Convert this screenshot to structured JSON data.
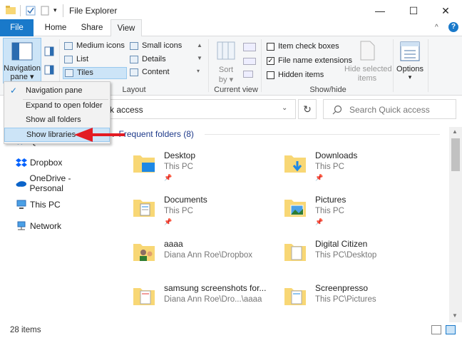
{
  "window": {
    "title": "File Explorer",
    "min": "—",
    "max": "☐",
    "close": "✕"
  },
  "tabs": [
    {
      "label": "File"
    },
    {
      "label": "Home"
    },
    {
      "label": "Share"
    },
    {
      "label": "View"
    }
  ],
  "ribbon": {
    "nav_pane": "Navigation\npane ▾",
    "nav_pane_line1": "Navigation",
    "nav_pane_line2": "pane ▾",
    "layouts": [
      "Medium icons",
      "Small icons",
      "List",
      "Details",
      "Tiles",
      "Content"
    ],
    "layout_group": "Layout",
    "sort_label": "Sort\nby",
    "sort_line1": "Sort",
    "sort_line2": "by ▾",
    "current_view_group": "Current view",
    "checks": [
      {
        "label": "Item check boxes",
        "checked": false
      },
      {
        "label": "File name extensions",
        "checked": true
      },
      {
        "label": "Hidden items",
        "checked": false
      }
    ],
    "hide_selected_line1": "Hide selected",
    "hide_selected_line2": "items",
    "options_label": "Options",
    "options_arrow": "▾",
    "show_hide_group": "Show/hide"
  },
  "menu": {
    "items": [
      {
        "label": "Navigation pane",
        "checked": true
      },
      {
        "label": "Expand to open folder",
        "checked": false
      },
      {
        "label": "Show all folders",
        "checked": false
      },
      {
        "label": "Show libraries",
        "checked": false
      }
    ]
  },
  "address": {
    "path_fragment": "ck access",
    "search_placeholder": "Search Quick access"
  },
  "nav": [
    {
      "label": "Quick access"
    },
    {
      "label": "Dropbox"
    },
    {
      "label": "OneDrive - Personal"
    },
    {
      "label": "This PC"
    },
    {
      "label": "Network"
    }
  ],
  "section": {
    "title": "Frequent folders (8)"
  },
  "tiles": [
    {
      "name": "Desktop",
      "sub": "This PC",
      "icon": "desktop-folder-icon"
    },
    {
      "name": "Downloads",
      "sub": "This PC",
      "icon": "downloads-folder-icon"
    },
    {
      "name": "Documents",
      "sub": "This PC",
      "icon": "documents-folder-icon"
    },
    {
      "name": "Pictures",
      "sub": "This PC",
      "icon": "pictures-folder-icon"
    },
    {
      "name": "aaaa",
      "sub": "Diana Ann Roe\\Dropbox",
      "icon": "shared-folder-icon"
    },
    {
      "name": "Digital Citizen",
      "sub": "This PC\\Desktop",
      "icon": "folder-icon"
    },
    {
      "name": "samsung screenshots for...",
      "sub": "Diana Ann Roe\\Dro...\\aaaa",
      "icon": "folder-icon"
    },
    {
      "name": "Screenpresso",
      "sub": "This PC\\Pictures",
      "icon": "folder-icon"
    }
  ],
  "status": {
    "count": "28 items"
  },
  "colors": {
    "accent": "#1979ca",
    "annotation_arrow": "#e31b23",
    "folder": "#f8d775"
  }
}
